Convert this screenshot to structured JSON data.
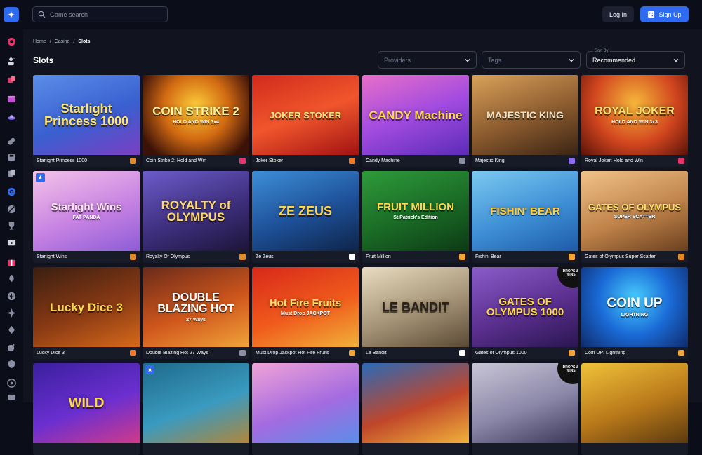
{
  "header": {
    "search_placeholder": "Game search",
    "login_label": "Log In",
    "signup_label": "Sign Up"
  },
  "breadcrumb": [
    "Home",
    "Casino",
    "Slots"
  ],
  "page": {
    "title": "Slots"
  },
  "filters": {
    "providers_placeholder": "Providers",
    "tags_placeholder": "Tags",
    "sort_label": "Sort By",
    "sort_value": "Recommended"
  },
  "games": [
    {
      "name": "Starlight Princess 1000",
      "art_title": "Starlight Princess 1000",
      "provider_icon": "provider-pragmatic-icon"
    },
    {
      "name": "Coin Strike 2: Hold and Win",
      "art_title": "COIN STRIKE 2",
      "art_sub": "HOLD AND WIN 3x4",
      "provider_icon": "provider-playson-icon"
    },
    {
      "name": "Joker Stoker",
      "art_title": "JOKER STOKER",
      "provider_icon": "provider-endorphina-icon"
    },
    {
      "name": "Candy Machine",
      "art_title": "CANDY Machine",
      "provider_icon": "provider-dots-icon"
    },
    {
      "name": "Majestic King",
      "art_title": "MAJESTIC KING",
      "provider_icon": "provider-purple-icon"
    },
    {
      "name": "Royal Joker: Hold and Win",
      "art_title": "ROYAL JOKER",
      "art_sub": "HOLD AND WIN 3x3",
      "provider_icon": "provider-playson-icon"
    },
    {
      "name": "Starlight Wins",
      "art_title": "Starlight Wins",
      "art_sub": "FAT PANDA",
      "provider_icon": "provider-pragmatic-icon",
      "badge": "star"
    },
    {
      "name": "Royalty Of Olympus",
      "art_title": "ROYALTY of OLYMPUS",
      "provider_icon": "provider-pragmatic-icon"
    },
    {
      "name": "Ze Zeus",
      "art_title": "ZE ZEUS",
      "provider_icon": "provider-hacksaw-icon"
    },
    {
      "name": "Fruit Million",
      "art_title": "FRUIT MILLION",
      "art_sub": "St.Patrick's Edition",
      "provider_icon": "provider-bgaming-icon"
    },
    {
      "name": "Fishin' Bear",
      "art_title": "FISHIN' BEAR",
      "provider_icon": "provider-bgaming-icon"
    },
    {
      "name": "Gates of Olympus Super Scatter",
      "art_title": "GATES OF OLYMPUS",
      "art_sub": "SUPER SCATTER",
      "provider_icon": "provider-pragmatic-icon"
    },
    {
      "name": "Lucky Dice 3",
      "art_title": "Lucky Dice 3",
      "provider_icon": "provider-endorphina-icon"
    },
    {
      "name": "Double Blazing Hot 27 Ways",
      "art_title": "DOUBLE BLAZING HOT",
      "art_sub": "27 Ways",
      "provider_icon": "provider-dots-icon"
    },
    {
      "name": "Must Drop Jackpot Hot Fire Fruits",
      "art_title": "Hot Fire Fruits",
      "art_sub": "Must Drop JACKPOT",
      "provider_icon": "provider-bgaming-icon"
    },
    {
      "name": "Le Bandit",
      "art_title": "LE BANDIT",
      "provider_icon": "provider-hacksaw-icon"
    },
    {
      "name": "Gates of Olympus 1000",
      "art_title": "GATES OF OLYMPUS 1000",
      "provider_icon": "provider-bgaming-icon",
      "badge": "drops"
    },
    {
      "name": "Coin UP: Lightning",
      "art_title": "COIN UP",
      "art_sub": "LIGHTNING",
      "provider_icon": "provider-bgaming-icon"
    },
    {
      "name": "",
      "art_title": "WILD",
      "provider_icon": ""
    },
    {
      "name": "",
      "art_title": "",
      "provider_icon": "",
      "badge": "star"
    },
    {
      "name": "",
      "art_title": "",
      "provider_icon": ""
    },
    {
      "name": "",
      "art_title": "",
      "provider_icon": ""
    },
    {
      "name": "",
      "art_title": "",
      "provider_icon": "",
      "badge": "drops"
    },
    {
      "name": "",
      "art_title": "",
      "provider_icon": ""
    }
  ],
  "badges": {
    "drops": "DROPS & WINS",
    "star": "★"
  },
  "colors": {
    "accent": "#2f6bf0",
    "bg": "#0b0d18",
    "panel": "#11141f"
  }
}
